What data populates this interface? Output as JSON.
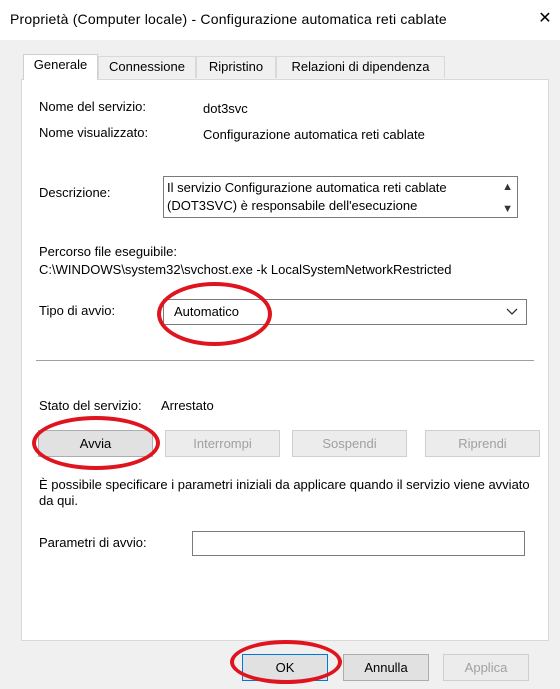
{
  "window": {
    "title": "Proprietà (Computer locale) - Configurazione automatica reti cablate"
  },
  "tabs": [
    {
      "label": "Generale",
      "active": true
    },
    {
      "label": "Connessione",
      "active": false
    },
    {
      "label": "Ripristino",
      "active": false
    },
    {
      "label": "Relazioni di dipendenza",
      "active": false
    }
  ],
  "general": {
    "service_name_label": "Nome del servizio:",
    "service_name_value": "dot3svc",
    "display_name_label": "Nome visualizzato:",
    "display_name_value": "Configurazione automatica reti cablate",
    "description_label": "Descrizione:",
    "description_value": "Il servizio Configurazione automatica reti cablate (DOT3SVC) è responsabile dell'esecuzione",
    "exe_path_label": "Percorso file eseguibile:",
    "exe_path_value": "C:\\WINDOWS\\system32\\svchost.exe -k LocalSystemNetworkRestricted",
    "startup_type_label": "Tipo di avvio:",
    "startup_type_value": "Automatico",
    "status_label": "Stato del servizio:",
    "status_value": "Arrestato",
    "buttons": {
      "start": "Avvia",
      "stop": "Interrompi",
      "pause": "Sospendi",
      "resume": "Riprendi"
    },
    "help_text": "È possibile specificare i parametri iniziali da applicare quando il servizio viene avviato da qui.",
    "start_params_label": "Parametri di avvio:",
    "start_params_value": ""
  },
  "footer": {
    "ok": "OK",
    "cancel": "Annulla",
    "apply": "Applica"
  },
  "colors": {
    "annotation_red": "#e0141e",
    "focus_blue": "#0078d7"
  },
  "icons": {
    "close": "close-icon",
    "dropdown": "chevron-down-icon",
    "scroll_up": "scroll-up-icon",
    "scroll_down": "scroll-down-icon"
  }
}
